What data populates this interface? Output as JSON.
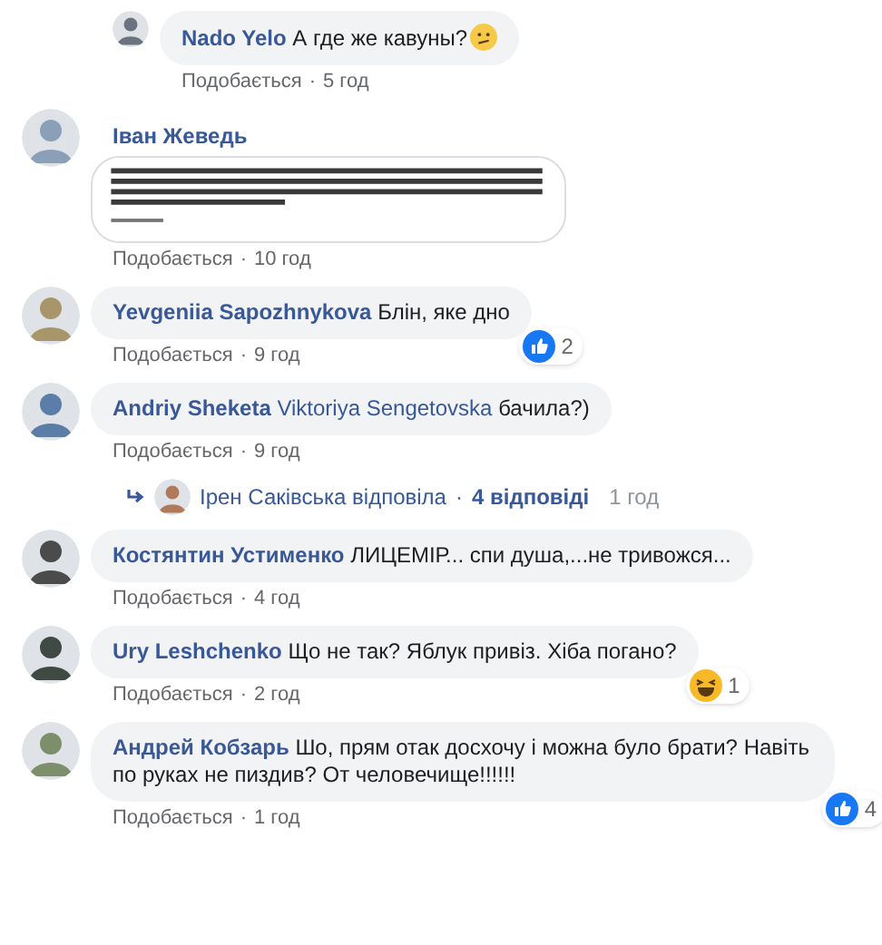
{
  "comments": [
    {
      "kind": "reply",
      "author": "Nado Yelo",
      "text": "А где же кавуны?",
      "has_emoji": true,
      "like_label": "Подобається",
      "separator": "·",
      "time": "5 год"
    },
    {
      "author": "Іван Жеведь",
      "like_label": "Подобається",
      "separator": "·",
      "time": "10 год"
    },
    {
      "kind": "text",
      "author": "Yevgeniia Sapozhnykova",
      "text": "Блін, яке дно",
      "like_label": "Подобається",
      "separator": "·",
      "time": "9 год",
      "reaction": {
        "kind": "like",
        "count": "2"
      }
    },
    {
      "kind": "text",
      "author": "Andriy Sheketa",
      "mention": "Viktoriya Sengetovska",
      "text": "бачила?)",
      "like_label": "Подобається",
      "separator": "·",
      "time": "9 год",
      "replies": {
        "who": "Ірен Саківська відповіла",
        "separator": "·",
        "count": "4 відповіді",
        "time": "1 год"
      }
    },
    {
      "kind": "text",
      "author": "Костянтин Устименко",
      "text": "ЛИЦЕМІР... спи душа,...не тривожся...",
      "like_label": "Подобається",
      "separator": "·",
      "time": "4 год"
    },
    {
      "kind": "text",
      "author": "Ury Leshchenko",
      "text": "Що не так? Яблук привіз. Хіба погано?",
      "like_label": "Подобається",
      "separator": "·",
      "time": "2 год",
      "reaction": {
        "kind": "haha",
        "count": "1"
      }
    },
    {
      "kind": "text",
      "author": "Андрей Кобзарь",
      "text": "Шо, прям отак досхочу і можна було брати? Навіть по руках не пиздив? От человечище!!!!!!",
      "like_label": "Подобається",
      "separator": "·",
      "time": "1 год",
      "reaction": {
        "kind": "like",
        "count": "4"
      }
    }
  ]
}
